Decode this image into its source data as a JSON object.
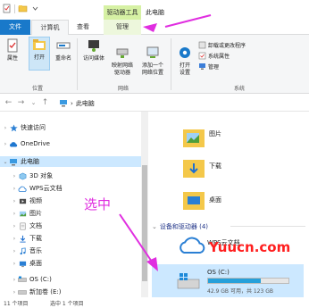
{
  "titlebar": {
    "context_tab": "驱动器工具",
    "title": "此电脑",
    "icons": [
      "properties-icon",
      "new-folder-icon",
      "dropdown-icon"
    ]
  },
  "tabs": {
    "file": "文件",
    "computer": "计算机",
    "view": "查看",
    "manage": "管理"
  },
  "ribbon": {
    "location": {
      "label": "位置",
      "buttons": [
        "属性",
        "打开",
        "重命名"
      ]
    },
    "network": {
      "label": "网络",
      "buttons": [
        "访问媒体",
        "映射网络\n驱动器",
        "添加一个\n网络位置"
      ]
    },
    "system": {
      "label": "系统",
      "open_settings": "打开\n设置",
      "items": [
        "卸载或更改程序",
        "系统属性",
        "管理"
      ]
    }
  },
  "address": {
    "path": "此电脑",
    "separator": "›"
  },
  "nav": {
    "items": [
      {
        "label": "快速访问",
        "icon": "star-icon"
      },
      {
        "label": "OneDrive",
        "icon": "cloud-icon"
      },
      {
        "label": "此电脑",
        "icon": "computer-icon"
      },
      {
        "label": "3D 对象",
        "icon": "3d-objects-icon"
      },
      {
        "label": "WPS云文档",
        "icon": "wps-cloud-icon"
      },
      {
        "label": "视频",
        "icon": "video-icon"
      },
      {
        "label": "图片",
        "icon": "pictures-icon"
      },
      {
        "label": "文档",
        "icon": "documents-icon"
      },
      {
        "label": "下载",
        "icon": "download-icon"
      },
      {
        "label": "音乐",
        "icon": "music-icon"
      },
      {
        "label": "桌面",
        "icon": "desktop-icon"
      },
      {
        "label": "OS (C:)",
        "icon": "drive-icon"
      },
      {
        "label": "新加卷 (E:)",
        "icon": "drive-icon"
      }
    ]
  },
  "content": {
    "folders": [
      "图片",
      "下载",
      "桌面"
    ],
    "group_header": "设备和驱动器 (4)",
    "wps": "WPS云文档",
    "drive": {
      "name": "OS (C:)",
      "info": "42.9 GB 可用，共 123 GB",
      "used_fraction": 0.65
    }
  },
  "status": {
    "items": "11 个项目",
    "selected": "选中 1 个项目"
  },
  "annotation": {
    "text": "选中",
    "color": "#e02ee0"
  },
  "watermark": "Yuucn.com",
  "colors": {
    "file_tab": "#1979ca",
    "context_tab": "#d6f1a4",
    "selection": "#cce8ff",
    "drive_fill": "#26a0da",
    "group_header": "#1e3287",
    "annotation": "#e02ee0",
    "watermark": "#ff1e1e"
  }
}
